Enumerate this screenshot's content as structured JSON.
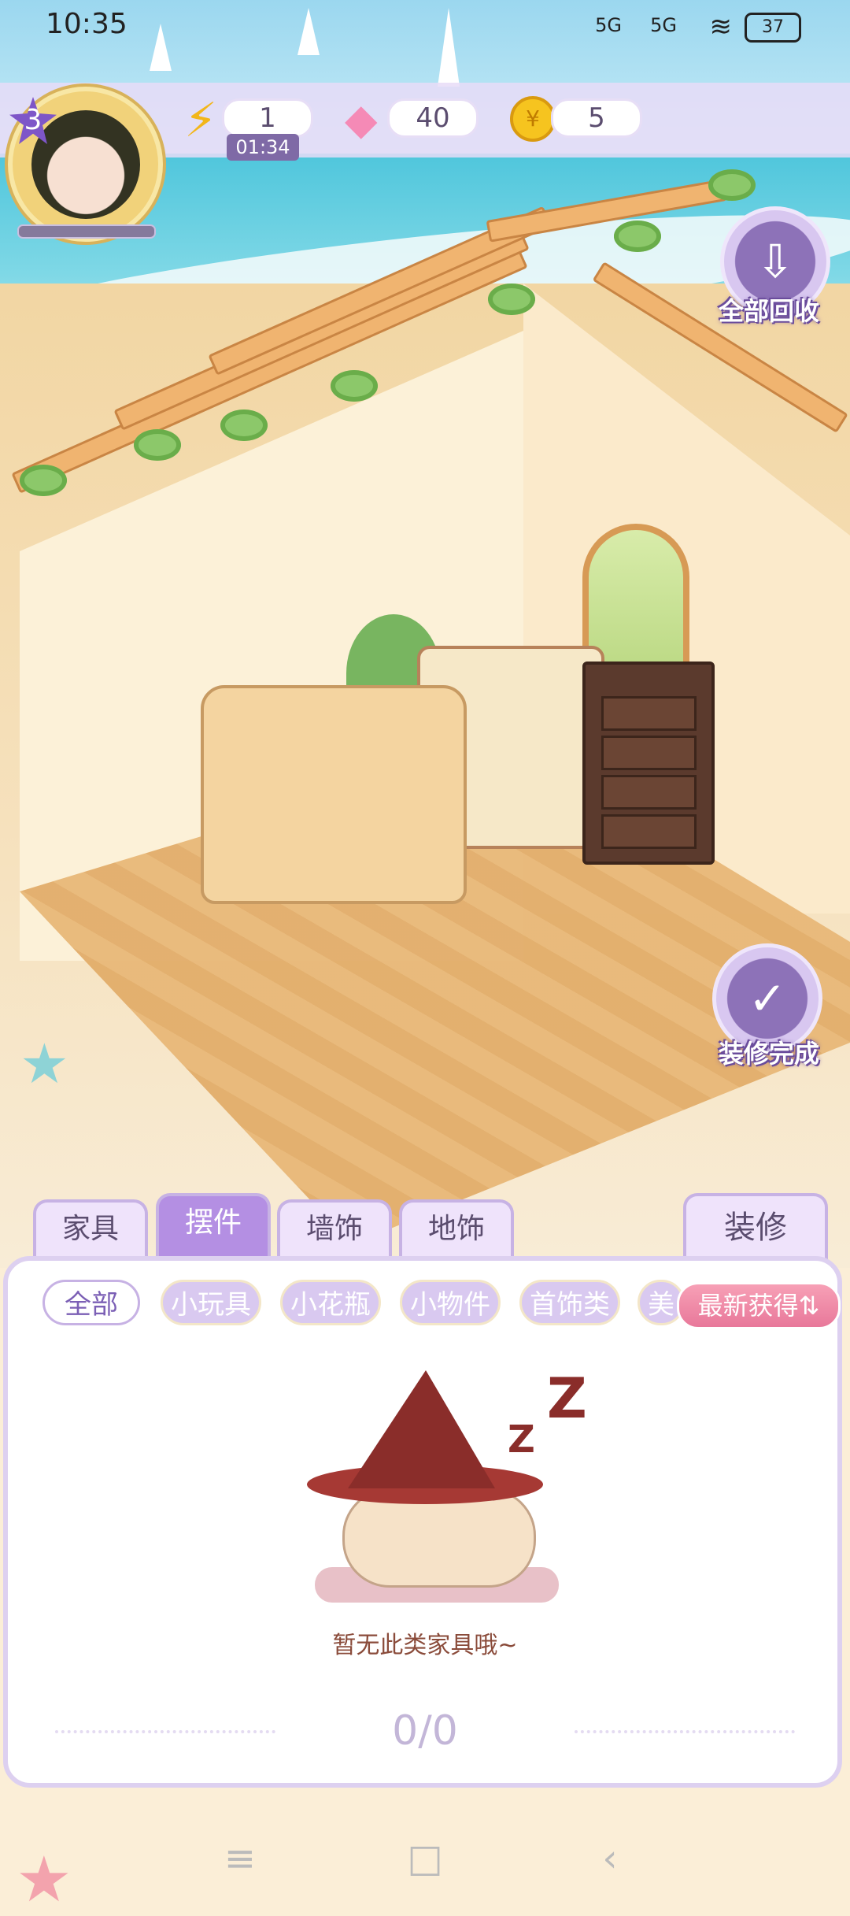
{
  "status_bar": {
    "time": "10:35",
    "network_1": "5G",
    "network_2": "5G",
    "battery": "37"
  },
  "hud": {
    "level": "3",
    "energy": "1",
    "energy_timer": "01:34",
    "gems": "40",
    "coins": "5"
  },
  "actions": {
    "recycle_all": "全部回收",
    "finish_decorating": "装修完成"
  },
  "category_tabs": [
    {
      "label": "家具",
      "active": false
    },
    {
      "label": "摆件",
      "active": true
    },
    {
      "label": "墙饰",
      "active": false
    },
    {
      "label": "地饰",
      "active": false
    }
  ],
  "decorate_button": "装修",
  "filter_chips": [
    {
      "label": "全部",
      "active": true
    },
    {
      "label": "小玩具",
      "active": false
    },
    {
      "label": "小花瓶",
      "active": false
    },
    {
      "label": "小物件",
      "active": false
    },
    {
      "label": "首饰类",
      "active": false
    },
    {
      "label": "美",
      "active": false
    }
  ],
  "sort_button": "最新获得⇅",
  "empty_state": {
    "message": "暂无此类家具哦~",
    "z_large": "Z",
    "z_small": "Z"
  },
  "pager": "0/0",
  "icons": {
    "energy": "lightning-icon",
    "gem": "gem-icon",
    "coin": "coin-icon",
    "recycle": "download-icon",
    "finish": "check-icon"
  }
}
